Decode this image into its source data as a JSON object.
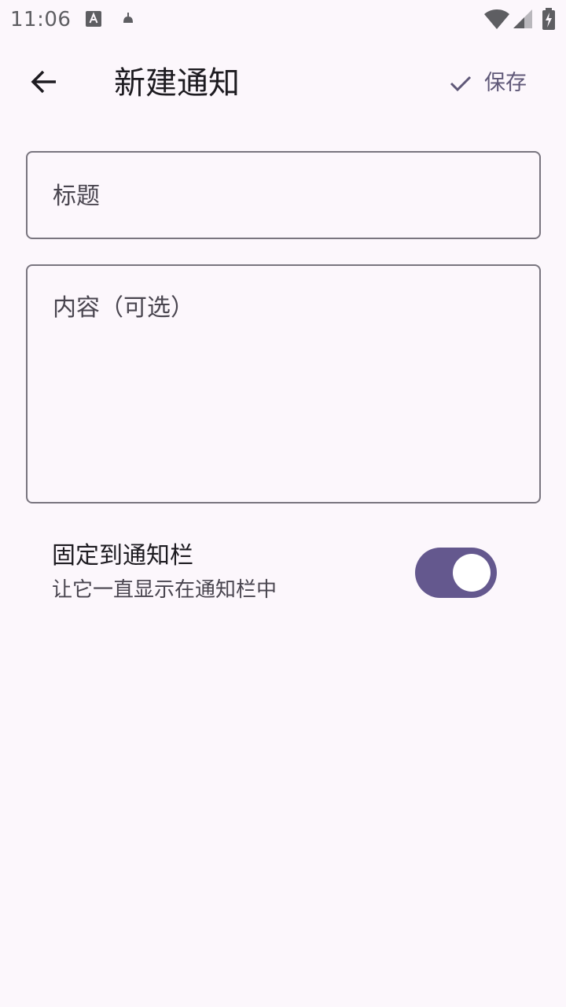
{
  "status_bar": {
    "time": "11:06",
    "icons": [
      "accessibility-a-icon",
      "android-icon",
      "wifi-icon",
      "signal-icon",
      "battery-charging-icon"
    ]
  },
  "app_bar": {
    "back_icon": "arrow-back-icon",
    "title": "新建通知",
    "save_icon": "check-icon",
    "save_label": "保存"
  },
  "form": {
    "title_placeholder": "标题",
    "content_placeholder": "内容（可选）"
  },
  "pin_setting": {
    "title": "固定到通知栏",
    "subtitle": "让它一直显示在通知栏中",
    "enabled": true
  },
  "colors": {
    "background": "#FCF7FC",
    "accent": "#64588E",
    "outline": "#79757F",
    "save_text": "#5F5878"
  }
}
